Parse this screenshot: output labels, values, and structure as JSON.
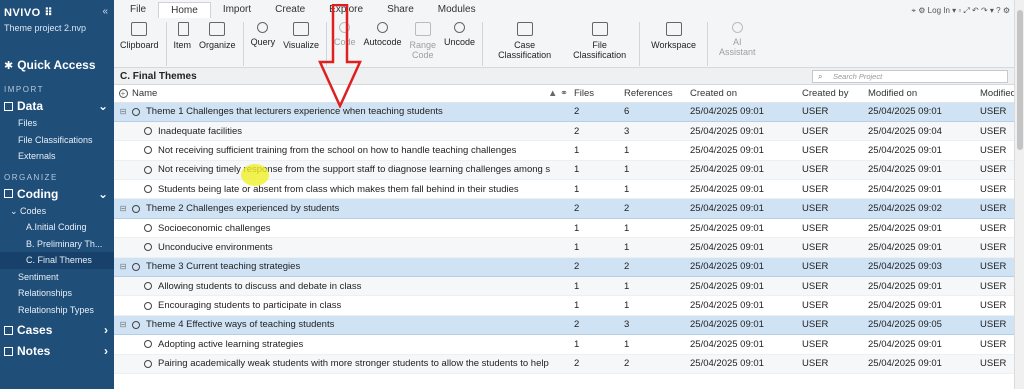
{
  "sidebar": {
    "logo": "NVIVO ⠿",
    "project": "Theme project 2.nvp",
    "quick_access": "Quick Access",
    "section_import": "IMPORT",
    "data_label": "Data",
    "data_items": [
      "Files",
      "File Classifications",
      "Externals"
    ],
    "section_organize": "ORGANIZE",
    "coding_label": "Coding",
    "codes_label": "Codes",
    "code_items": [
      "A.Initial Coding",
      "B. Preliminary Th...",
      "C. Final Themes"
    ],
    "coding_items": [
      "Sentiment",
      "Relationships",
      "Relationship Types"
    ],
    "cases_label": "Cases",
    "notes_label": "Notes"
  },
  "ribbon": {
    "tabs": [
      "File",
      "Home",
      "Import",
      "Create",
      "Explore",
      "Share",
      "Modules"
    ],
    "active_tab": "Home",
    "right_controls": "⌖ ⚙  Log In  ▾  ▫  ⤢  ↶  ↷  ▾  ?  ⚙",
    "tools": {
      "clipboard": "Clipboard",
      "item": "Item",
      "organize": "Organize",
      "query": "Query",
      "visualize": "Visualize",
      "code": "Code",
      "autocode": "Autocode",
      "range_code_1": "Range",
      "range_code_2": "Code",
      "uncode": "Uncode",
      "case_class_1": "Case",
      "case_class_2": "Classification",
      "file_class_1": "File",
      "file_class_2": "Classification",
      "workspace": "Workspace",
      "ai_1": "AI",
      "ai_2": "Assistant"
    }
  },
  "content": {
    "title": "C. Final Themes",
    "search_placeholder": "Search Project",
    "columns": [
      "Name",
      "Files",
      "References",
      "Created on",
      "Created by",
      "Modified on",
      "Modified by"
    ],
    "rows": [
      {
        "type": "theme",
        "name": "Theme 1  Challenges that lecturers experience when teaching students",
        "files": "2",
        "refs": "6",
        "created": "25/04/2025 09:01",
        "by": "USER",
        "modified": "25/04/2025 09:01",
        "modby": "USER"
      },
      {
        "type": "child",
        "name": "Inadequate facilities",
        "files": "2",
        "refs": "3",
        "created": "25/04/2025 09:01",
        "by": "USER",
        "modified": "25/04/2025 09:04",
        "modby": "USER"
      },
      {
        "type": "child",
        "name": "Not receiving sufficient training from the school on how to handle teaching challenges",
        "files": "1",
        "refs": "1",
        "created": "25/04/2025 09:01",
        "by": "USER",
        "modified": "25/04/2025 09:01",
        "modby": "USER"
      },
      {
        "type": "child",
        "name": "Not receiving timely response from the support staff to diagnose learning challenges among s",
        "files": "1",
        "refs": "1",
        "created": "25/04/2025 09:01",
        "by": "USER",
        "modified": "25/04/2025 09:01",
        "modby": "USER"
      },
      {
        "type": "child",
        "name": "Students being late or absent from class which makes them fall behind in their studies",
        "files": "1",
        "refs": "1",
        "created": "25/04/2025 09:01",
        "by": "USER",
        "modified": "25/04/2025 09:01",
        "modby": "USER"
      },
      {
        "type": "theme",
        "name": "Theme 2 Challenges experienced by students",
        "files": "2",
        "refs": "2",
        "created": "25/04/2025 09:01",
        "by": "USER",
        "modified": "25/04/2025 09:02",
        "modby": "USER"
      },
      {
        "type": "child",
        "name": "Socioeconomic challenges",
        "files": "1",
        "refs": "1",
        "created": "25/04/2025 09:01",
        "by": "USER",
        "modified": "25/04/2025 09:01",
        "modby": "USER"
      },
      {
        "type": "child",
        "name": "Unconducive environments",
        "files": "1",
        "refs": "1",
        "created": "25/04/2025 09:01",
        "by": "USER",
        "modified": "25/04/2025 09:01",
        "modby": "USER"
      },
      {
        "type": "theme",
        "name": "Theme 3 Current teaching strategies",
        "files": "2",
        "refs": "2",
        "created": "25/04/2025 09:01",
        "by": "USER",
        "modified": "25/04/2025 09:03",
        "modby": "USER"
      },
      {
        "type": "child",
        "name": "Allowing students to discuss and debate in class",
        "files": "1",
        "refs": "1",
        "created": "25/04/2025 09:01",
        "by": "USER",
        "modified": "25/04/2025 09:01",
        "modby": "USER"
      },
      {
        "type": "child",
        "name": "Encouraging students to participate in class",
        "files": "1",
        "refs": "1",
        "created": "25/04/2025 09:01",
        "by": "USER",
        "modified": "25/04/2025 09:01",
        "modby": "USER"
      },
      {
        "type": "theme",
        "name": "Theme 4 Effective ways of teaching students",
        "files": "2",
        "refs": "3",
        "created": "25/04/2025 09:01",
        "by": "USER",
        "modified": "25/04/2025 09:05",
        "modby": "USER"
      },
      {
        "type": "child",
        "name": "Adopting  active learning strategies",
        "files": "1",
        "refs": "1",
        "created": "25/04/2025 09:01",
        "by": "USER",
        "modified": "25/04/2025 09:01",
        "modby": "USER"
      },
      {
        "type": "child",
        "name": "Pairing academically weak students with more stronger students to allow the students to help",
        "files": "2",
        "refs": "2",
        "created": "25/04/2025 09:01",
        "by": "USER",
        "modified": "25/04/2025 09:01",
        "modby": "USER"
      }
    ]
  },
  "colors": {
    "sidebar": "#1f4e79",
    "theme_row": "#cfe3f5",
    "arrow": "#e02020",
    "cursor_highlight": "#f0f028"
  }
}
